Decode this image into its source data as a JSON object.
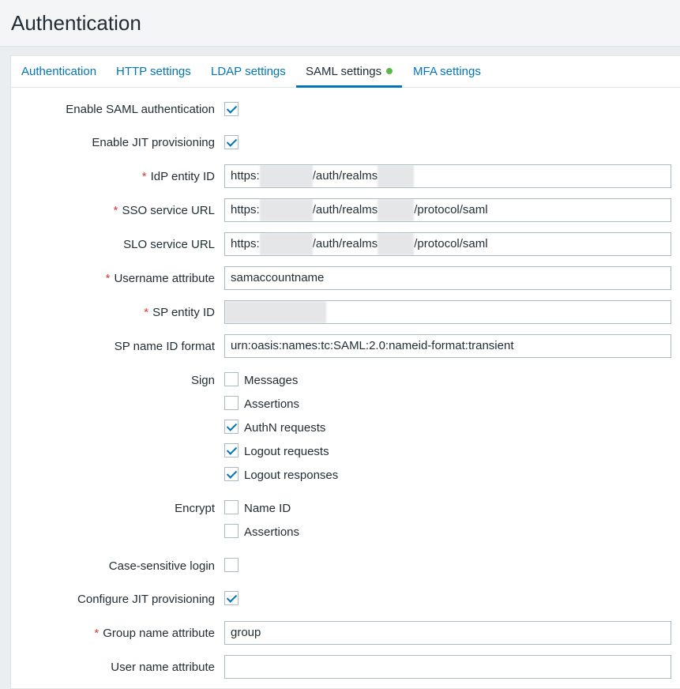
{
  "page": {
    "title": "Authentication"
  },
  "tabs": [
    {
      "label": "Authentication"
    },
    {
      "label": "HTTP settings"
    },
    {
      "label": "LDAP settings"
    },
    {
      "label": "SAML settings"
    },
    {
      "label": "MFA settings"
    }
  ],
  "active_tab_status_color": "#59b84a",
  "form": {
    "enable_saml": {
      "label": "Enable SAML authentication",
      "checked": true
    },
    "enable_jit": {
      "label": "Enable JIT provisioning",
      "checked": true
    },
    "idp_entity_id": {
      "label": "IdP entity ID",
      "required": true,
      "value_prefix": "https:",
      "value_mid": "/auth/realms",
      "value_suffix": ""
    },
    "sso_service_url": {
      "label": "SSO service URL",
      "required": true,
      "value_prefix": "https:",
      "value_mid": "/auth/realms",
      "value_suffix": "/protocol/saml"
    },
    "slo_service_url": {
      "label": "SLO service URL",
      "required": false,
      "value_prefix": "https:",
      "value_mid": "/auth/realms",
      "value_suffix": "/protocol/saml"
    },
    "username_attribute": {
      "label": "Username attribute",
      "required": true,
      "value": "samaccountname"
    },
    "sp_entity_id": {
      "label": "SP entity ID",
      "required": true,
      "value": ""
    },
    "sp_name_id_format": {
      "label": "SP name ID format",
      "value": "urn:oasis:names:tc:SAML:2.0:nameid-format:transient"
    },
    "sign": {
      "label": "Sign",
      "options": [
        {
          "label": "Messages",
          "checked": false
        },
        {
          "label": "Assertions",
          "checked": false
        },
        {
          "label": "AuthN requests",
          "checked": true
        },
        {
          "label": "Logout requests",
          "checked": true
        },
        {
          "label": "Logout responses",
          "checked": true
        }
      ]
    },
    "encrypt": {
      "label": "Encrypt",
      "options": [
        {
          "label": "Name ID",
          "checked": false
        },
        {
          "label": "Assertions",
          "checked": false
        }
      ]
    },
    "case_sensitive_login": {
      "label": "Case-sensitive login",
      "checked": false
    },
    "configure_jit": {
      "label": "Configure JIT provisioning",
      "checked": true
    },
    "group_name_attribute": {
      "label": "Group name attribute",
      "required": true,
      "value": "group"
    },
    "user_name_attribute": {
      "label": "User name attribute",
      "required": false,
      "value": ""
    }
  }
}
